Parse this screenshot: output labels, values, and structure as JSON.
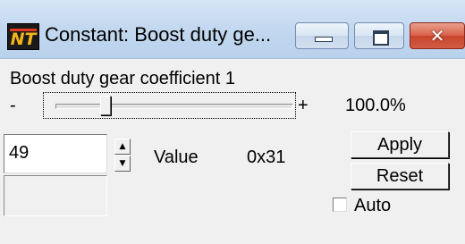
{
  "window": {
    "title": "Constant: Boost duty ge...",
    "app_icon_text": "NT",
    "controls": {
      "minimize": "minimize-icon",
      "maximize": "maximize-icon",
      "close": "close-icon"
    },
    "close_glyph": "✕"
  },
  "parameter": {
    "caption": "Boost duty gear coefficient 1",
    "slider": {
      "minus_label": "-",
      "plus_label": "+",
      "position_fraction": 0.2,
      "percent": "100.0%"
    },
    "value_input": "49",
    "spin_up": "▲",
    "spin_down": "▼",
    "value_label": "Value",
    "hex_value": "0x31"
  },
  "buttons": {
    "apply": "Apply",
    "reset": "Reset"
  },
  "auto": {
    "label": "Auto",
    "checked": false
  },
  "colors": {
    "close_button": "#d35c44",
    "title_gradient": "#c4d9f0",
    "icon_accent": "#f2b51c"
  }
}
